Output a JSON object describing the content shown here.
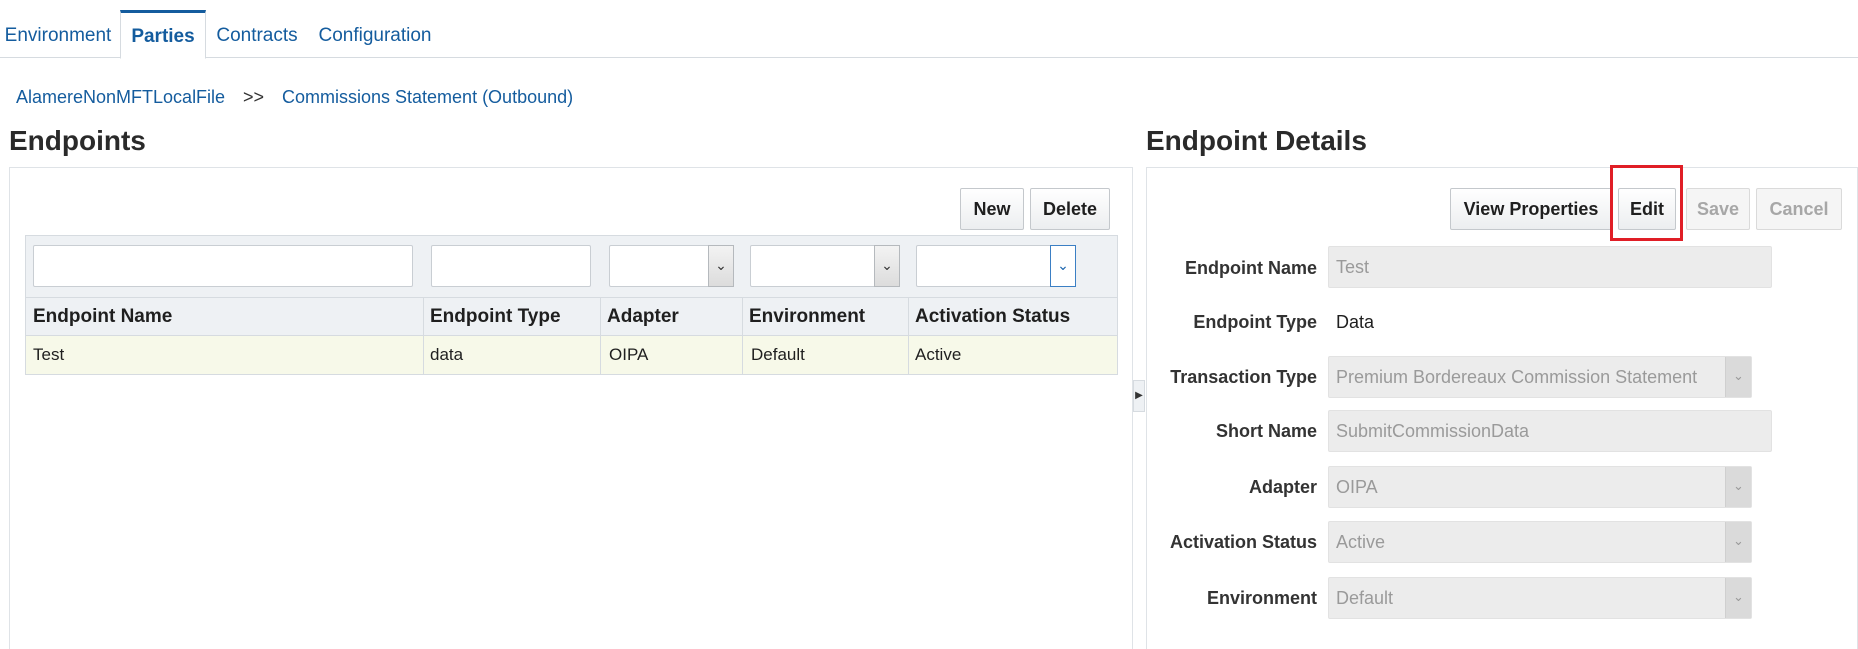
{
  "tabs": [
    {
      "label": "Environment"
    },
    {
      "label": "Parties"
    },
    {
      "label": "Contracts"
    },
    {
      "label": "Configuration"
    }
  ],
  "active_tab": "Parties",
  "breadcrumb": {
    "parent": "AlamereNonMFTLocalFile",
    "separator": ">>",
    "current": "Commissions Statement (Outbound)"
  },
  "endpoints": {
    "title": "Endpoints",
    "new_label": "New",
    "delete_label": "Delete",
    "columns": [
      "Endpoint Name",
      "Endpoint Type",
      "Adapter",
      "Environment",
      "Activation Status"
    ],
    "rows": [
      [
        "Test",
        "data",
        "OIPA",
        "Default",
        "Active"
      ]
    ]
  },
  "details": {
    "title": "Endpoint Details",
    "view_properties_label": "View Properties",
    "edit_label": "Edit",
    "save_label": "Save",
    "cancel_label": "Cancel",
    "fields": {
      "endpoint_name": {
        "label": "Endpoint Name",
        "value": "Test"
      },
      "endpoint_type": {
        "label": "Endpoint Type",
        "value": "Data"
      },
      "transaction_type": {
        "label": "Transaction Type",
        "value": "Premium Bordereaux Commission Statement"
      },
      "short_name": {
        "label": "Short Name",
        "value": "SubmitCommissionData"
      },
      "adapter": {
        "label": "Adapter",
        "value": "OIPA"
      },
      "activation_status": {
        "label": "Activation Status",
        "value": "Active"
      },
      "environment": {
        "label": "Environment",
        "value": "Default"
      }
    }
  },
  "colors": {
    "link": "#145c9e",
    "highlight": "#e01e26",
    "selected_row": "#f7f9e9"
  }
}
